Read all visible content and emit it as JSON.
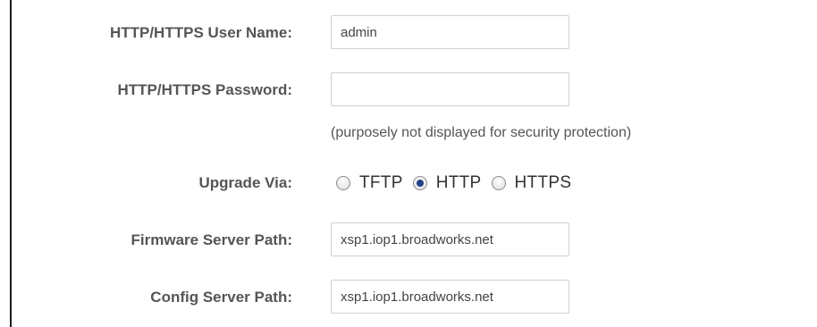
{
  "form": {
    "username": {
      "label": "HTTP/HTTPS User Name:",
      "value": "admin"
    },
    "password": {
      "label": "HTTP/HTTPS Password:",
      "value": "",
      "note": "(purposely not displayed for security protection)"
    },
    "upgrade_via": {
      "label": "Upgrade Via:",
      "options": [
        {
          "label": "TFTP",
          "checked": false
        },
        {
          "label": "HTTP",
          "checked": true
        },
        {
          "label": "HTTPS",
          "checked": false
        }
      ]
    },
    "firmware_server_path": {
      "label": "Firmware Server Path:",
      "value": "xsp1.iop1.broadworks.net"
    },
    "config_server_path": {
      "label": "Config Server Path:",
      "value": "xsp1.iop1.broadworks.net"
    }
  }
}
